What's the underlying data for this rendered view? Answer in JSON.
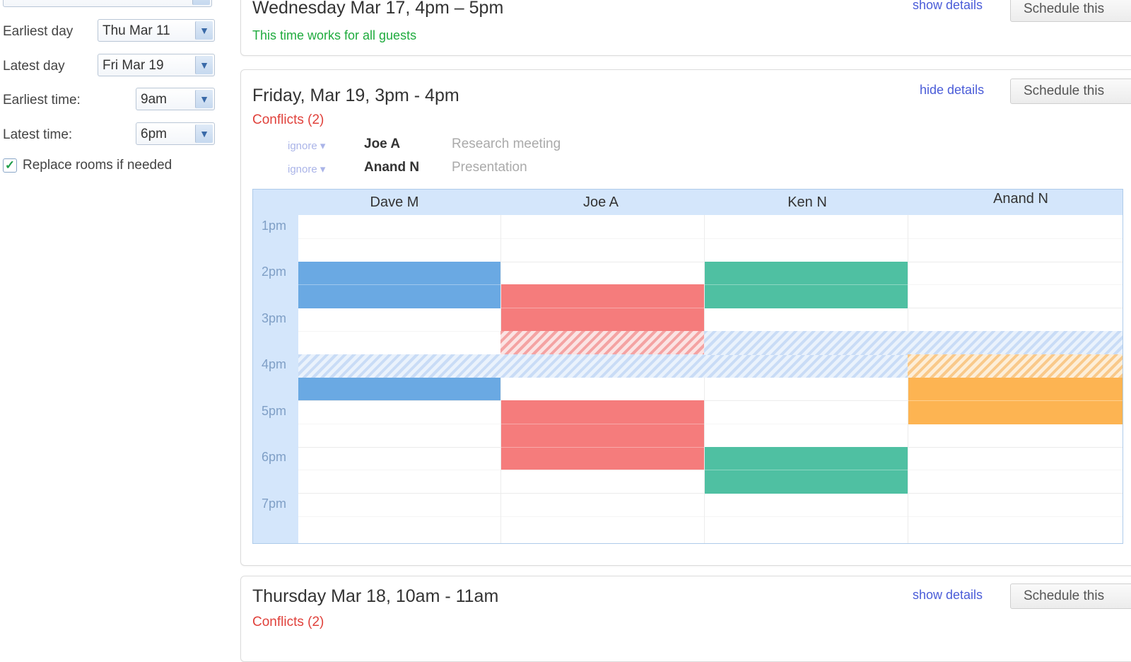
{
  "sidebar": {
    "earliest_day": {
      "label": "Earliest day",
      "value": "Thu Mar 11"
    },
    "latest_day": {
      "label": "Latest day",
      "value": "Fri Mar 19"
    },
    "earliest_time": {
      "label": "Earliest time:",
      "value": "9am"
    },
    "latest_time": {
      "label": "Latest  time:",
      "value": "6pm"
    },
    "replace_rooms": {
      "label": "Replace rooms if needed",
      "checked": true
    }
  },
  "suggestions": [
    {
      "title": "Wednesday Mar 17, 4pm – 5pm",
      "status": "This time works for all guests",
      "details_link": "show details",
      "button": "Schedule this"
    },
    {
      "title": "Friday, Mar 19, 3pm - 4pm",
      "status": "Conflicts (2)",
      "details_link": "hide details",
      "button": "Schedule this",
      "conflicts": [
        {
          "ignore": "ignore ▾",
          "person": "Joe A",
          "event": "Research meeting"
        },
        {
          "ignore": "ignore ▾",
          "person": "Anand N",
          "event": "Presentation"
        }
      ],
      "grid": {
        "columns": [
          "Dave M",
          "Joe A",
          "Ken N",
          "Anand N"
        ],
        "times": [
          "1pm",
          "2pm",
          "3pm",
          "4pm",
          "5pm",
          "6pm",
          "7pm"
        ]
      }
    },
    {
      "title": "Thursday Mar 18, 10am - 11am",
      "status": "Conflicts (2)",
      "details_link": "show details",
      "button": "Schedule this"
    }
  ],
  "colors": {
    "accent_link": "#4a5cd8",
    "ok_green": "#1fab3e",
    "conflict_red": "#e0413b",
    "dave_blue": "#6aa9e3",
    "joe_red": "#f57c7c",
    "ken_green": "#4fc0a2",
    "anand_orange": "#fdb452"
  }
}
